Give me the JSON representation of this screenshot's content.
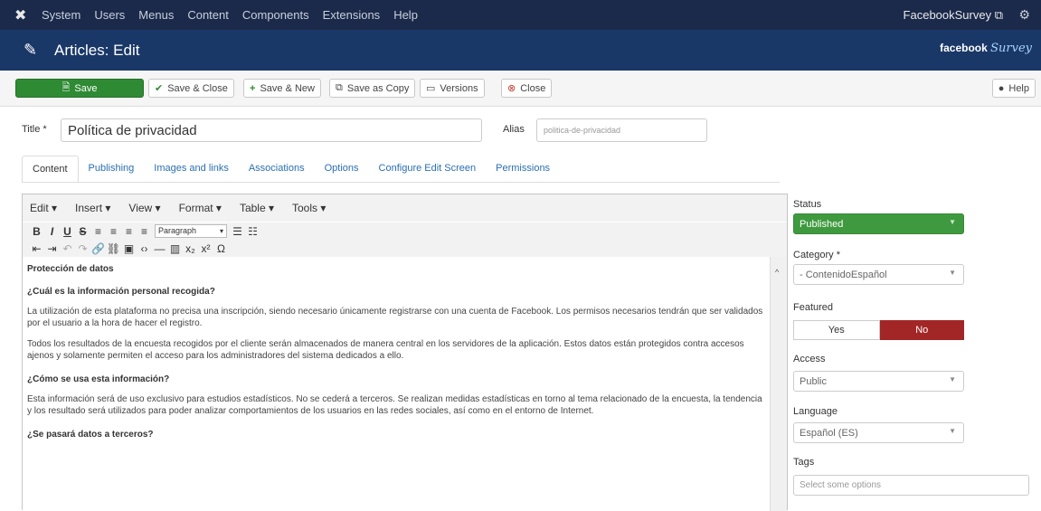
{
  "topnav": {
    "logo_icon": "joomla-icon",
    "menu": [
      "System",
      "Users",
      "Menus",
      "Content",
      "Components",
      "Extensions",
      "Help"
    ],
    "site_name": "FacebookSurvey ⧉",
    "settings_icon": "gear-icon"
  },
  "header": {
    "icon": "pencil-icon",
    "title": "Articles: Edit",
    "brand": "facebook",
    "brand_script": "Survey"
  },
  "toolbar": {
    "save": "Save",
    "save_close": "Save & Close",
    "save_new": "Save & New",
    "save_copy": "Save as Copy",
    "versions": "Versions",
    "close": "Close",
    "help": "Help"
  },
  "form": {
    "title_label": "Title *",
    "title_value": "Política de privacidad",
    "alias_label": "Alias",
    "alias_value": "politica-de-privacidad"
  },
  "tabs": [
    "Content",
    "Publishing",
    "Images and links",
    "Associations",
    "Options",
    "Configure Edit Screen",
    "Permissions"
  ],
  "editor": {
    "menus": [
      "Edit ▾",
      "Insert ▾",
      "View ▾",
      "Format ▾",
      "Table ▾",
      "Tools ▾"
    ],
    "format_select": "Paragraph",
    "content": {
      "h1": "Protección de datos",
      "h2": "¿Cuál es la información personal recogida?",
      "p1": "La utilización de esta plataforma no precisa una inscripción, siendo necesario únicamente registrarse con una cuenta de Facebook. Los permisos necesarios tendrán que ser validados por el usuario a la hora de hacer el registro.",
      "p2": "Todos los resultados de la encuesta recogidos por el cliente serán almacenados de manera central en los servidores de la aplicación. Estos datos están protegidos contra accesos ajenos y solamente permiten el acceso para los administradores del sistema dedicados a ello.",
      "h3": "¿Cómo se usa esta información?",
      "p3": "Esta información será de uso exclusivo para estudios estadísticos. No se cederá a terceros. Se realizan medidas estadísticas en torno al tema relacionado de la encuesta, la tendencia y los resultado será utilizados para poder analizar comportamientos de los usuarios en las redes sociales, así como en el entorno de Internet.",
      "h4": "¿Se pasará datos a terceros?"
    }
  },
  "sidebar": {
    "status_label": "Status",
    "status_value": "Published",
    "category_label": "Category *",
    "category_value": "- ContenidoEspañol",
    "featured_label": "Featured",
    "featured_yes": "Yes",
    "featured_no": "No",
    "access_label": "Access",
    "access_value": "Public",
    "language_label": "Language",
    "language_value": "Español (ES)",
    "tags_label": "Tags",
    "tags_placeholder": "Select some options"
  },
  "colors": {
    "topnav": "#1b2a4b",
    "header": "#1a3867",
    "save": "#2f8a34",
    "published": "#3f9a3f",
    "no": "#a32626",
    "link": "#2a6fb3"
  }
}
